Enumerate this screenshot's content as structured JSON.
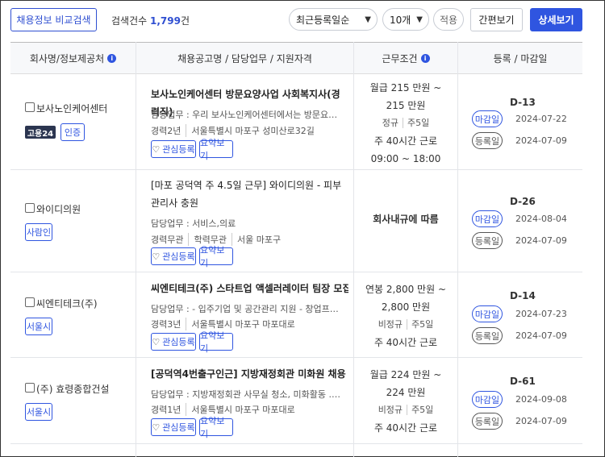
{
  "toolbar": {
    "compare_label": "채용정보 비교검색",
    "count_prefix": "검색건수",
    "count_value": "1,799",
    "count_suffix": "건",
    "sort_value": "최근등록일순",
    "rows_value": "10개",
    "apply_label": "적용",
    "simple_label": "간편보기",
    "detail_label": "상세보기"
  },
  "headers": {
    "company": "회사명/정보제공처",
    "title": "채용공고명 / 담당업무 / 지원자격",
    "condition": "근무조건",
    "date": "등록 / 마감일"
  },
  "rows": [
    {
      "company": "보사노인케어센터",
      "badge_dark": "고용24",
      "tag": "인증",
      "title": "보사노인케어센터 방문요양사업 사회복지사(경력직)",
      "duty": "담당업무 : 우리 보사노인케어센터에서는 방문요양사업 …",
      "meta1": "경력2년",
      "meta2": "서울특별시 마포구 성미산로32길",
      "fav": "관심등록",
      "summary": "요약보기",
      "pay1": "월급 215 만원 ~",
      "pay2": "215 만원",
      "type": "정규",
      "days": "주5일",
      "hours": "주 40시간 근로",
      "time": "09:00 ~ 18:00",
      "dday": "D-13",
      "close_label": "마감일",
      "close_date": "2024-07-22",
      "reg_label": "등록일",
      "reg_date": "2024-07-09"
    },
    {
      "company": "와이디의원",
      "tag": "사람인",
      "title": "[마포 공덕역 주 4.5일 근무] 와이디의원 - 피부관리사 충원",
      "duty": "담당업무 : 서비스,의료",
      "meta1": "경력무관",
      "meta2": "학력무관",
      "meta3": "서울 마포구",
      "fav": "관심등록",
      "summary": "요약보기",
      "pay1": "회사내규에 따름",
      "dday": "D-26",
      "close_label": "마감일",
      "close_date": "2024-08-04",
      "reg_label": "등록일",
      "reg_date": "2024-07-09"
    },
    {
      "company": "씨엔티테크(주)",
      "tag": "서울시",
      "title": "씨엔티테크(주) 스타트업 액셀러레이터 팀장 모집(제…",
      "duty": "담당업무 : - 입주기업 및 공간관리 지원 - 창업프로그램…",
      "meta1": "경력3년",
      "meta2": "서울특별시 마포구 마포대로",
      "fav": "관심등록",
      "summary": "요약보기",
      "pay1": "연봉 2,800 만원 ~",
      "pay2": "2,800 만원",
      "type": "비정규",
      "days": "주5일",
      "hours": "주 40시간 근로",
      "dday": "D-14",
      "close_label": "마감일",
      "close_date": "2024-07-23",
      "reg_label": "등록일",
      "reg_date": "2024-07-09"
    },
    {
      "company": "(주) 효령종합건설",
      "tag": "서울시",
      "title": "[공덕역4번출구인근] 지방재정회관 미화원 채용",
      "duty": "담당업무 : 지방재정회관 사무실 청소, 미화활동 .근무…",
      "meta1": "경력1년",
      "meta2": "서울특별시 마포구 마포대로",
      "fav": "관심등록",
      "summary": "요약보기",
      "pay1": "월급 224 만원 ~",
      "pay2": "224 만원",
      "type": "비정규",
      "days": "주5일",
      "hours": "주 40시간 근로",
      "dday": "D-61",
      "close_label": "마감일",
      "close_date": "2024-09-08",
      "reg_label": "등록일",
      "reg_date": "2024-07-09"
    }
  ]
}
